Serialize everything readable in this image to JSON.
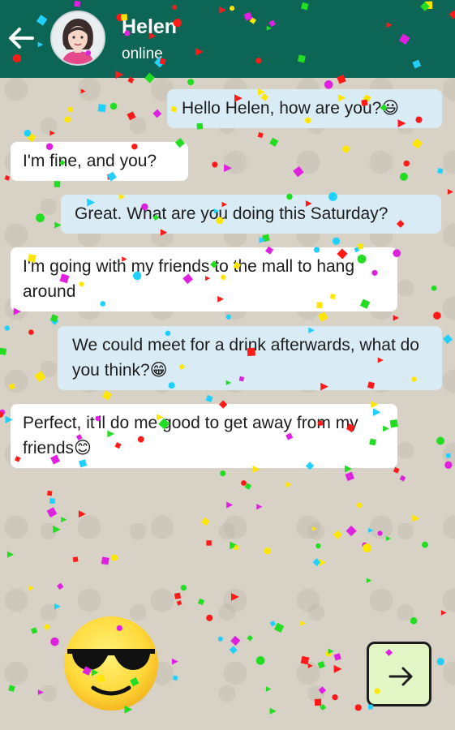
{
  "header": {
    "contact_name": "Helen",
    "status": "online",
    "bg_color": "#0d6655"
  },
  "icons": {
    "back": "back-arrow-icon",
    "avatar": "avatar",
    "sunglasses_emoji": "sunglasses-emoji-icon",
    "next": "arrow-right-icon"
  },
  "messages": [
    {
      "side": "outgoing",
      "text": "Hello Helen, how are you?😃"
    },
    {
      "side": "incoming",
      "text": "I'm fine, and you?"
    },
    {
      "side": "outgoing",
      "text": "Great. What are you doing this Saturday?"
    },
    {
      "side": "incoming",
      "text": "I'm going with my friends to the mall to hang around"
    },
    {
      "side": "outgoing",
      "text": "We could meet for a drink afterwards, what do you think?😁"
    },
    {
      "side": "incoming",
      "text": "Perfect, it'll do me good to get away from my friends😊"
    }
  ],
  "colors": {
    "outgoing_bubble": "#d9ecf6",
    "incoming_bubble": "#ffffff",
    "next_button": "#e2f6c6",
    "confetti": [
      "#ff1a1a",
      "#ffe600",
      "#22dd22",
      "#e020e0",
      "#20d0ff"
    ]
  }
}
